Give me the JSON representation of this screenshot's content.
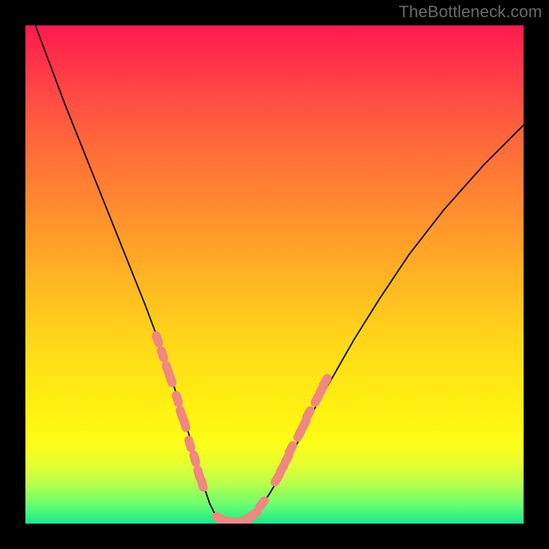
{
  "watermark": "TheBottleneck.com",
  "chart_data": {
    "type": "line",
    "title": "",
    "xlabel": "",
    "ylabel": "",
    "xlim": [
      0,
      100
    ],
    "ylim": [
      0,
      100
    ],
    "series": [
      {
        "name": "curve",
        "x": [
          2,
          5,
          8,
          12,
          16,
          20,
          24,
          27,
          29,
          31,
          32.5,
          34,
          35,
          36,
          37,
          38,
          39.5,
          41,
          43,
          45,
          47,
          49,
          52,
          55,
          58,
          62,
          66,
          71,
          77,
          84,
          92,
          100
        ],
        "y": [
          100,
          92,
          84,
          74,
          64,
          54,
          44,
          36,
          30,
          24,
          19,
          14,
          10,
          7,
          4,
          2,
          1,
          0,
          0,
          1,
          3,
          6,
          11,
          17,
          23,
          30,
          37,
          45,
          54,
          63,
          72,
          80
        ]
      }
    ],
    "markers": {
      "color": "#f08780",
      "points": [
        {
          "x": 26.5,
          "y": 37
        },
        {
          "x": 27.5,
          "y": 34
        },
        {
          "x": 28.5,
          "y": 31
        },
        {
          "x": 29.2,
          "y": 29
        },
        {
          "x": 30.5,
          "y": 25
        },
        {
          "x": 31.3,
          "y": 22
        },
        {
          "x": 32.0,
          "y": 20
        },
        {
          "x": 33.0,
          "y": 16
        },
        {
          "x": 34.0,
          "y": 13
        },
        {
          "x": 34.8,
          "y": 10
        },
        {
          "x": 35.5,
          "y": 8
        },
        {
          "x": 39.0,
          "y": 1
        },
        {
          "x": 40.0,
          "y": 0.5
        },
        {
          "x": 41.0,
          "y": 0.3
        },
        {
          "x": 42.0,
          "y": 0.2
        },
        {
          "x": 43.0,
          "y": 0.3
        },
        {
          "x": 44.0,
          "y": 0.7
        },
        {
          "x": 45.0,
          "y": 1.2
        },
        {
          "x": 46.0,
          "y": 2.0
        },
        {
          "x": 47.5,
          "y": 4.0
        },
        {
          "x": 50.5,
          "y": 9
        },
        {
          "x": 51.5,
          "y": 11
        },
        {
          "x": 52.5,
          "y": 13
        },
        {
          "x": 53.3,
          "y": 15
        },
        {
          "x": 55.0,
          "y": 18
        },
        {
          "x": 56.0,
          "y": 20
        },
        {
          "x": 56.8,
          "y": 22
        },
        {
          "x": 58.5,
          "y": 25
        },
        {
          "x": 59.5,
          "y": 27
        },
        {
          "x": 60.2,
          "y": 28.5
        }
      ]
    },
    "background_gradient": {
      "top": "#ff1a4d",
      "bottom": "#17ea8f"
    }
  }
}
